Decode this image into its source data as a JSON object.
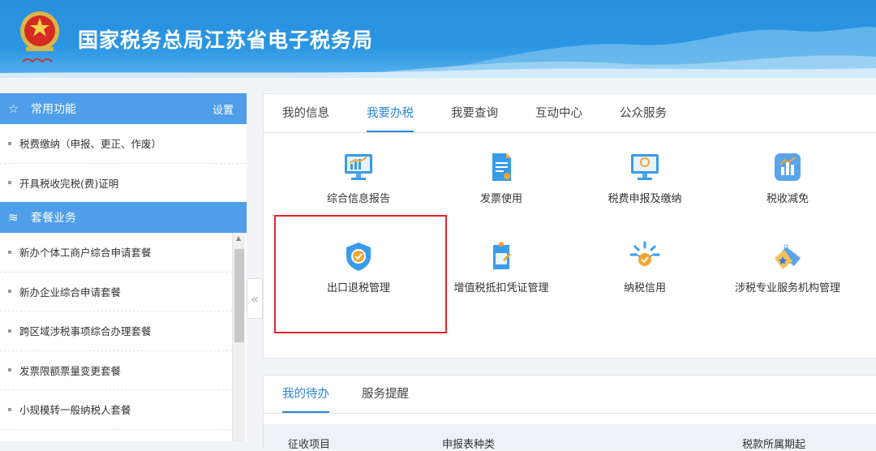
{
  "header": {
    "title": "国家税务总局江苏省电子税务局"
  },
  "sidebar": {
    "common": {
      "title": "常用功能",
      "settings": "设置",
      "items": [
        "税费缴纳（申报、更正、作废）",
        "开具税收完税(费)证明"
      ]
    },
    "packages": {
      "title": "套餐业务",
      "items": [
        "新办个体工商户综合申请套餐",
        "新办企业综合申请套餐",
        "跨区域涉税事项综合办理套餐",
        "发票限额票量变更套餐",
        "小规模转一般纳税人套餐"
      ]
    },
    "collapse_glyph": "«"
  },
  "main": {
    "tabs": [
      "我的信息",
      "我要办税",
      "我要查询",
      "互动中心",
      "公众服务"
    ],
    "active_tab": "我要办税",
    "services": [
      {
        "label": "综合信息报告",
        "icon": "monitor-chart-icon"
      },
      {
        "label": "发票使用",
        "icon": "invoice-document-icon"
      },
      {
        "label": "税费申报及缴纳",
        "icon": "monitor-coin-icon"
      },
      {
        "label": "税收减免",
        "icon": "bar-chart-icon"
      },
      {
        "label": "出口退税管理",
        "icon": "shield-check-icon"
      },
      {
        "label": "增值税抵扣凭证管理",
        "icon": "certificate-icon"
      },
      {
        "label": "纳税信用",
        "icon": "credit-badge-icon"
      },
      {
        "label": "涉税专业服务机构管理",
        "icon": "tag-star-icon"
      }
    ]
  },
  "todo": {
    "tabs": [
      "我的待办",
      "服务提醒"
    ],
    "columns": [
      "征收项目",
      "申报表种类",
      "税款所属期起"
    ]
  },
  "colors": {
    "primary": "#2a86d8",
    "highlight": "#e0242a",
    "sidebar_head": "#4e9ee9"
  }
}
